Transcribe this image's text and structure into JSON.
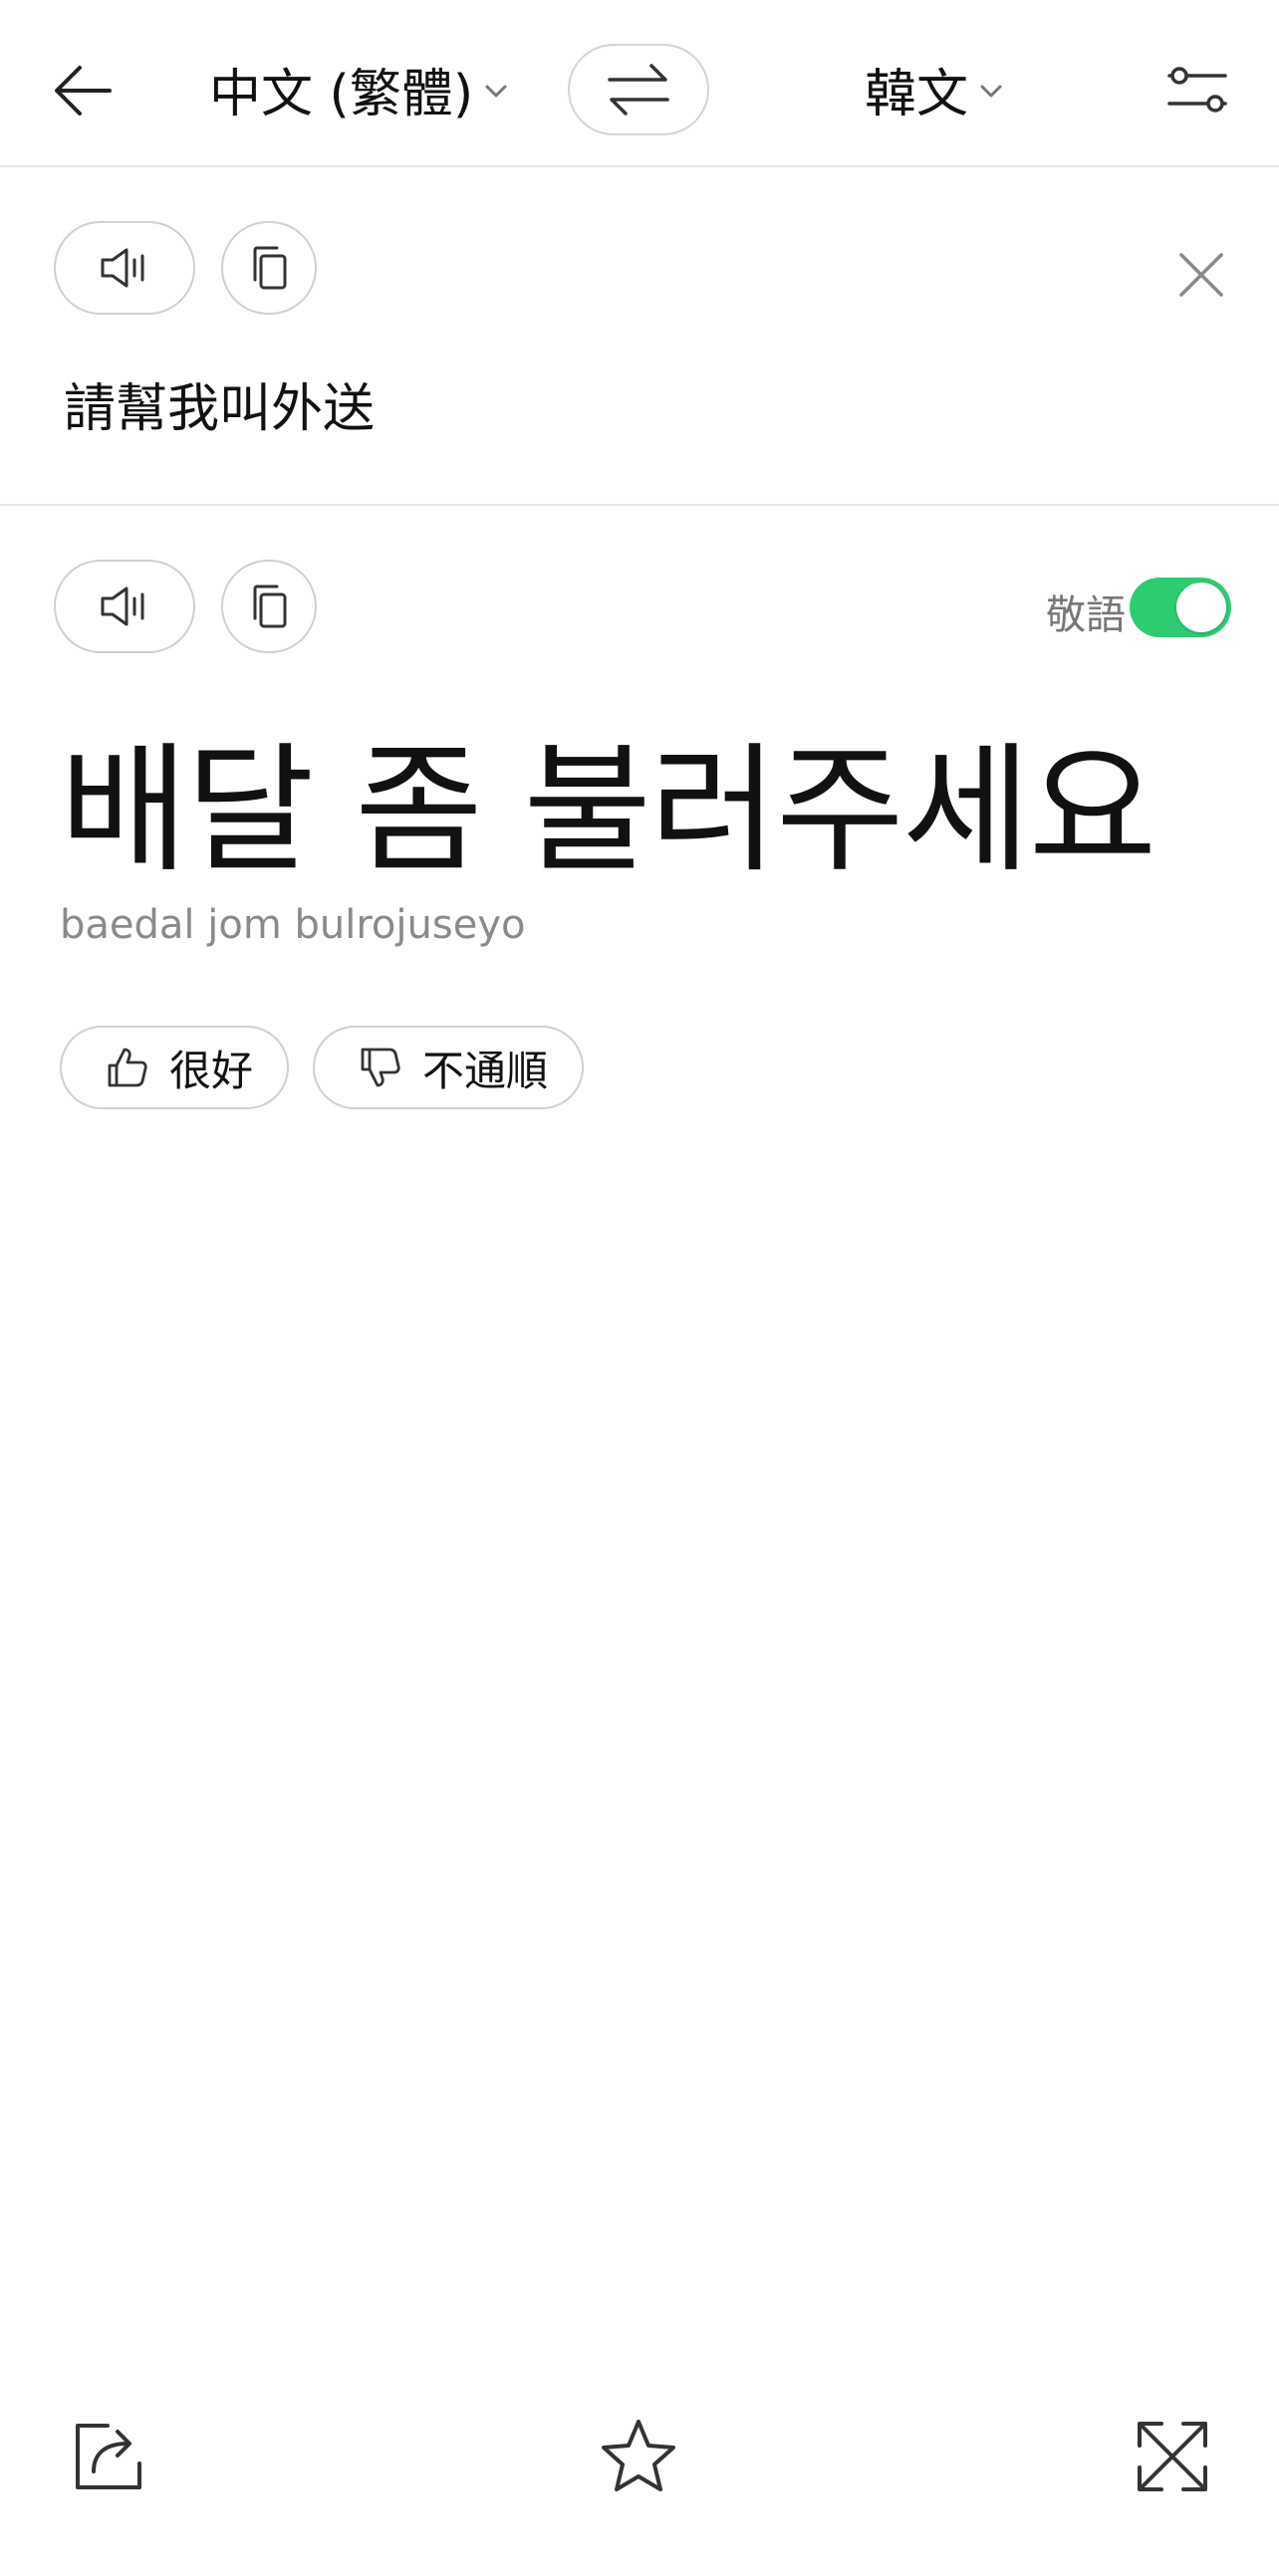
{
  "header": {
    "source_language": "中文 (繁體)",
    "target_language": "韓文",
    "icons": {
      "back": "arrow-left-icon",
      "swap": "swap-arrows-icon",
      "settings": "sliders-icon",
      "chevron": "chevron-down-icon"
    }
  },
  "source": {
    "text": "請幫我叫外送",
    "icons": {
      "speak": "speaker-icon",
      "copy": "copy-icon",
      "clear": "close-icon"
    }
  },
  "result": {
    "honorific_label": "敬語",
    "honorific_enabled": true,
    "translation": "배달 좀 불러주세요",
    "romanization": "baedal jom bulrojuseyo",
    "feedback": {
      "good_label": "很好",
      "bad_label": "不通順"
    }
  },
  "bottom_bar": {
    "icons": [
      "share-icon",
      "star-icon",
      "expand-icon"
    ]
  },
  "colors": {
    "toggle_on": "#2ecc71",
    "secondary_text": "#8a8a8a",
    "border": "#d0d0d0"
  }
}
